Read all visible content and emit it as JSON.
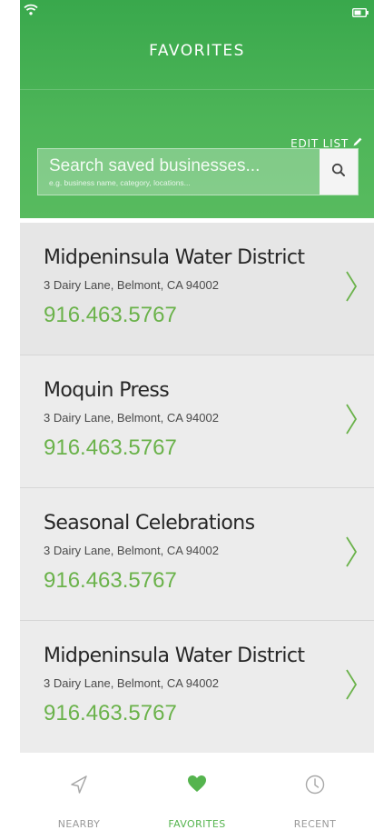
{
  "colors": {
    "accent": "#55b44e",
    "header_top": "#39a84c",
    "phone": "#6ab24a"
  },
  "header": {
    "title": "FAVORITES",
    "edit_label": "EDIT LIST"
  },
  "search": {
    "placeholder": "Search saved businesses...",
    "hint": "e.g. business name, category, locations..."
  },
  "favorites": [
    {
      "name": "Midpeninsula Water District",
      "address": "3 Dairy Lane, Belmont, CA 94002",
      "phone": "916.463.5767"
    },
    {
      "name": "Moquin Press",
      "address": "3 Dairy Lane, Belmont, CA 94002",
      "phone": "916.463.5767"
    },
    {
      "name": "Seasonal Celebrations",
      "address": "3 Dairy Lane, Belmont, CA 94002",
      "phone": "916.463.5767"
    },
    {
      "name": "Midpeninsula Water District",
      "address": "3 Dairy Lane, Belmont, CA 94002",
      "phone": "916.463.5767"
    }
  ],
  "tabs": [
    {
      "label": "NEARBY",
      "icon": "navigation-arrow-icon",
      "active": false
    },
    {
      "label": "FAVORITES",
      "icon": "heart-icon",
      "active": true
    },
    {
      "label": "RECENT",
      "icon": "clock-icon",
      "active": false
    }
  ]
}
